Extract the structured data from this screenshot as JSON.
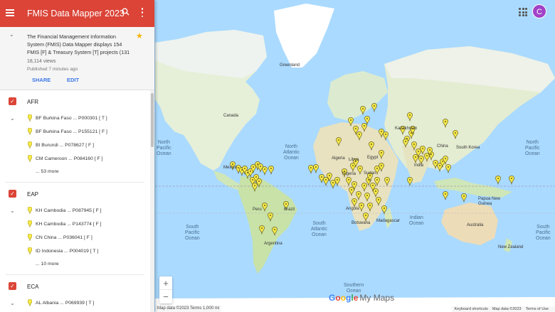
{
  "app": {
    "title": "FMIS Data Mapper 2023"
  },
  "info": {
    "description": "The Financial Management Information System (FMIS) Data Mapper displays 154 FMIS [F] & Treasury System [T] projects (131",
    "views": "18,114 views",
    "published": "Published 7 minutes ago",
    "share_label": "SHARE",
    "edit_label": "EDIT"
  },
  "layers": [
    {
      "name": "AFR",
      "items": [
        "BF Burkina Faso ... P000301 [ T ]",
        "BF Burkina Faso ... P155121 [ F ]",
        "BI Burundi ... P078627 [ F ]",
        "CM Cameroon ... P084160 [ F ]"
      ],
      "more": "... 53 more"
    },
    {
      "name": "EAP",
      "items": [
        "KH Cambodia ... P087945 [ F ]",
        "KH Cambodia ... P143774 [ F ]",
        "CN China ... P036041 [ F ]",
        "ID Indonesia ... P004019 [ T ]"
      ],
      "more": "... 10 more"
    },
    {
      "name": "ECA",
      "items": [
        "AL Albania ... P069939 [ T ]"
      ],
      "more": ""
    }
  ],
  "map": {
    "labels": {
      "greenland": "Greenland",
      "north_pacific": "North\nPacific\nOcean",
      "north_pacific_right": "North\nPacific\nOcean",
      "north_atlantic": "North\nAtlantic\nOcean",
      "south_atlantic": "South\nAtlantic\nOcean",
      "south_pacific": "South\nPacific\nOcean",
      "south_pacific_right": "South\nPacific\nOcean",
      "indian": "Indian\nOcean",
      "southern": "Southern\nOcean",
      "canada": "Canada",
      "kazakhstan": "Kazakhstan",
      "china": "China",
      "south_korea": "South Korea",
      "india": "India",
      "algeria": "Algeria",
      "libya": "Libya",
      "egypt": "Egypt",
      "sudan": "Sudan",
      "nigeria": "Nigeria",
      "angola": "Angola",
      "botswana": "Botswana",
      "madagascar": "Madagascar",
      "brazil": "Brazil",
      "peru": "Peru",
      "argentina": "Argentina",
      "mexico": "Mexico",
      "australia": "Australia",
      "new_zealand": "New Zealand",
      "papua": "Papua New\nGuinea"
    },
    "google_logo_parts": [
      "G",
      "o",
      "o",
      "g",
      "l",
      "e"
    ],
    "my_maps_label": "My Maps",
    "zoom_in": "+",
    "zoom_out": "−",
    "attribution_left": "Map data ©2023   Terms   1,000 mi",
    "attribution_right": [
      "Keyboard shortcuts",
      "Map data ©2023",
      "Terms of Use"
    ],
    "pin_color": "#f7ea48",
    "accent_color": "#db4437",
    "avatar_letter": "C",
    "avatar_color": "#a142c7"
  }
}
